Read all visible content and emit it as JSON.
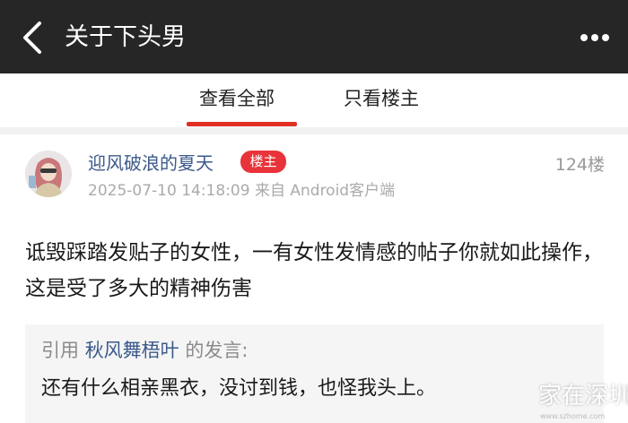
{
  "header": {
    "title": "关于下头男",
    "back_icon": "chevron-left-icon",
    "more_icon": "more-horizontal-icon",
    "background": "#262626"
  },
  "tabs": [
    {
      "label": "查看全部",
      "active": true
    },
    {
      "label": "只看楼主",
      "active": false
    }
  ],
  "accent_color": "#e02e24",
  "post": {
    "author": "迎风破浪的夏天",
    "badge": "楼主",
    "floor": "124楼",
    "timestamp": "2025-07-10 14:18:09",
    "source": "来自 Android客户端",
    "content": "诋毁踩踏发贴子的女性，一有女性发情感的帖子你就如此操作，这是受了多大的精神伤害",
    "quote": {
      "prefix": "引用",
      "user": "秋风舞梧叶",
      "suffix": "的发言:",
      "text": "还有什么相亲黑衣，没讨到钱，也怪我头上。"
    }
  },
  "watermark": {
    "text": "家在深圳",
    "sub": "www.szhome.com"
  }
}
